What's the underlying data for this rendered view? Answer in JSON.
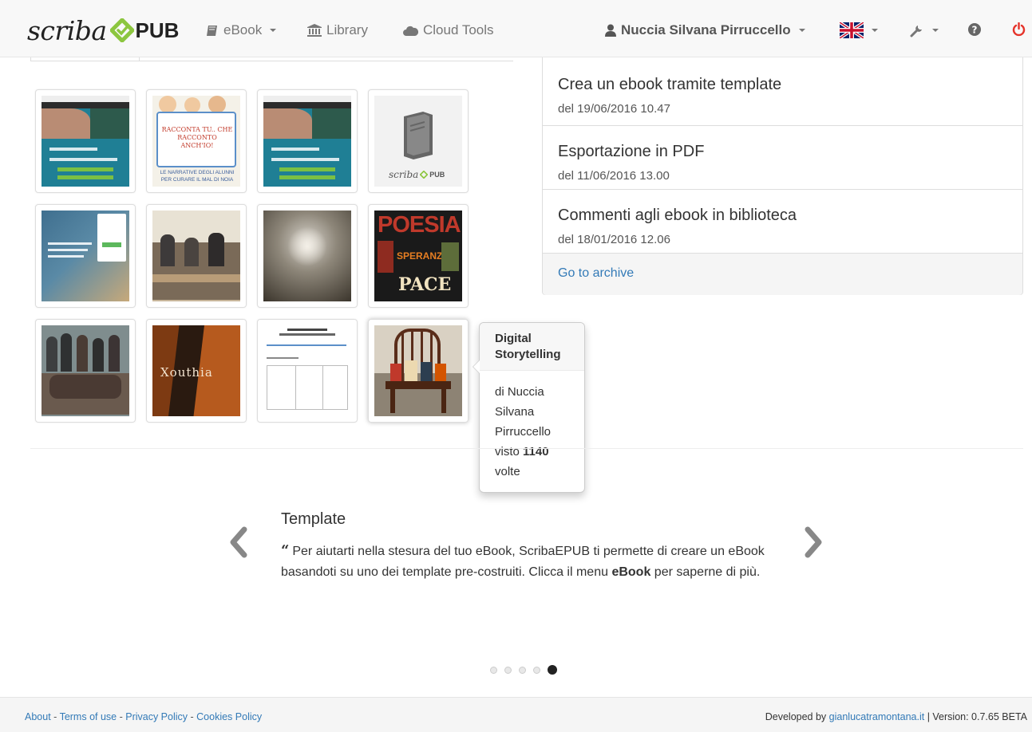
{
  "navbar": {
    "brand_script": "scriba",
    "brand_pub": "PUB",
    "ebook_label": "eBook",
    "library_label": "Library",
    "cloud_label": "Cloud Tools",
    "user_label": "Nuccia Silvana Pirruccello"
  },
  "news": {
    "items": [
      {
        "title": "Crea un ebook tramite template",
        "date": "del 19/06/2016 10.47"
      },
      {
        "title": "Esportazione in PDF",
        "date": "del 11/06/2016 13.00"
      },
      {
        "title": "Commenti agli ebook in biblioteca",
        "date": "del 18/01/2016 12.06"
      }
    ],
    "archive_link": "Go to archive"
  },
  "thumbnails": {
    "placeholder_logo": "scriba",
    "placeholder_logo_pub": "PUB",
    "book1_text": "RACCONTA TU.. CHE RACCONTO ANCH'IO!",
    "book1_caption": "LE NARRATIVE DEGLI ALUNNI PER CURARE IL MAL DI NOIA",
    "poesia_title": "POESIA",
    "poesia_word2": "SPERANZA",
    "poesia_word3": "PACE",
    "xouthia_title": "Xouthia"
  },
  "popover": {
    "title": "Digital Storytelling",
    "line1": "di Nuccia Silvana Pirruccello",
    "visto": "visto",
    "views": "1140",
    "volte": "volte"
  },
  "carousel": {
    "title": "Template",
    "text_before": "Per aiutarti nella stesura del tuo eBook, ScribaEPUB ti permette di creare un eBook basandoti su uno dei template pre-costruiti. Clicca il menu",
    "text_bold": "eBook",
    "text_after": "per saperne di più.",
    "active_dot": 4,
    "dot_count": 5
  },
  "footer": {
    "about": "About",
    "terms": "Terms of use",
    "privacy": "Privacy Policy",
    "cookies": "Cookies Policy",
    "developed_by": "Developed by",
    "dev_link": "gianlucatramontana.it",
    "version": "| Version: 0.7.65 BETA"
  },
  "colors": {
    "brand_green": "#8cc63f",
    "link_blue": "#337ab7",
    "power_red": "#e5332a"
  },
  "icons": [
    "book-icon",
    "bank-icon",
    "cloud-icon",
    "user-icon",
    "uk-flag-icon",
    "wrench-icon",
    "question-icon",
    "power-icon",
    "quote-icon",
    "chevron-left-icon",
    "chevron-right-icon"
  ]
}
